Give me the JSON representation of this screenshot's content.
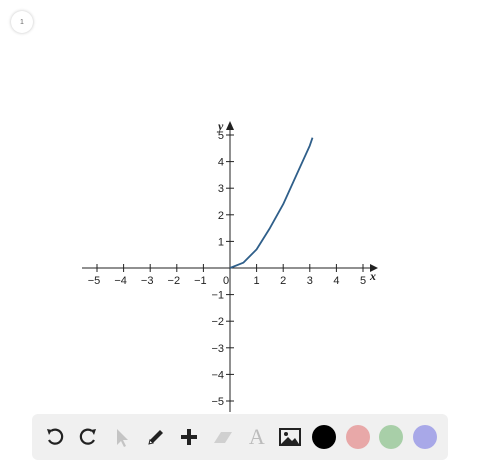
{
  "page": {
    "badge": "1"
  },
  "graph": {
    "x_ticks": [
      "−5",
      "−4",
      "−3",
      "−2",
      "−1",
      "0",
      "1",
      "2",
      "3",
      "4",
      "5"
    ],
    "y_ticks": [
      "−5",
      "−4",
      "−3",
      "−2",
      "−1",
      "1",
      "2",
      "3",
      "4",
      "5"
    ],
    "x_axis_label": "x",
    "y_axis_label": "y",
    "curve_color": "#2f5f8a",
    "axis_color": "#222222"
  },
  "chart_data": {
    "type": "line",
    "title": "",
    "xlabel": "x",
    "ylabel": "y",
    "xlim": [
      -5,
      5
    ],
    "ylim": [
      -5,
      5
    ],
    "grid": false,
    "series": [
      {
        "x": [
          0,
          0.5,
          1,
          1.5,
          2,
          2.5,
          3,
          3.1
        ],
        "y": [
          0,
          0.2,
          0.7,
          1.5,
          2.4,
          3.5,
          4.6,
          4.9
        ]
      }
    ]
  },
  "toolbar": {
    "tools": [
      {
        "name": "undo-icon"
      },
      {
        "name": "redo-icon"
      },
      {
        "name": "cursor-icon"
      },
      {
        "name": "pencil-icon"
      },
      {
        "name": "plus-icon"
      },
      {
        "name": "eraser-icon"
      },
      {
        "name": "text-icon",
        "label": "A"
      },
      {
        "name": "image-icon"
      }
    ],
    "colors": [
      "#000000",
      "#e8a8a8",
      "#a8cfa8",
      "#a8a8e8"
    ]
  }
}
